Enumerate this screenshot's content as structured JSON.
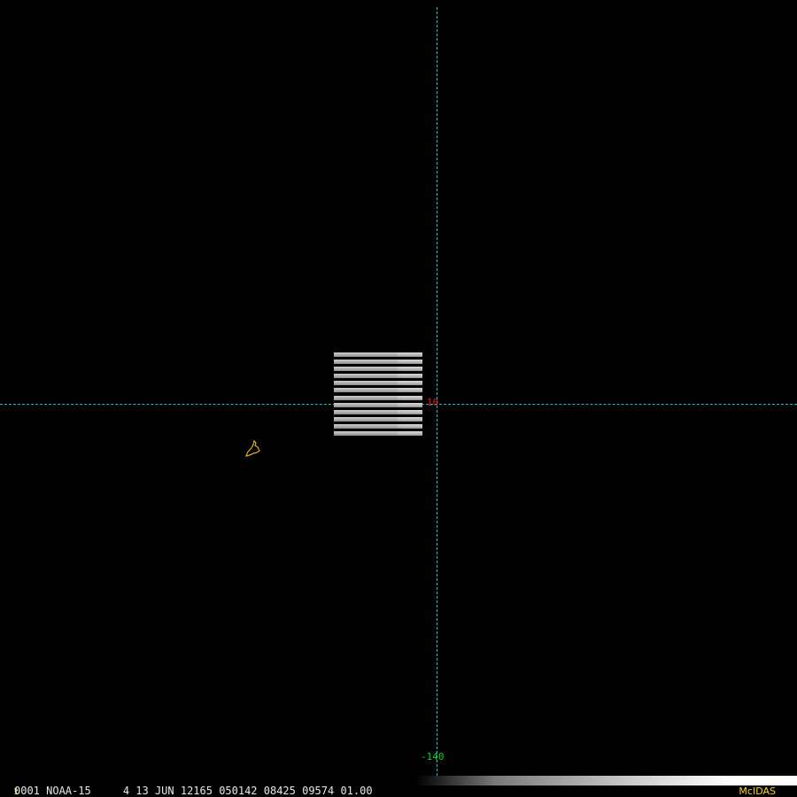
{
  "map": {
    "latitude_label": "10",
    "longitude_label": "-140",
    "gridline_color": "#19c2c2",
    "latitude_label_color": "#e01a1a",
    "longitude_label_color": "#1ad01a",
    "coastline_color": "#ffd21a"
  },
  "swath": {
    "scan_line_count": 12
  },
  "status": {
    "frame_number": "1",
    "info": "0001 NOAA-15     4 13 JUN 12165 050142 08425 09574 01.00",
    "brand": "McIDAS",
    "brand_color": "#ffd21a"
  }
}
